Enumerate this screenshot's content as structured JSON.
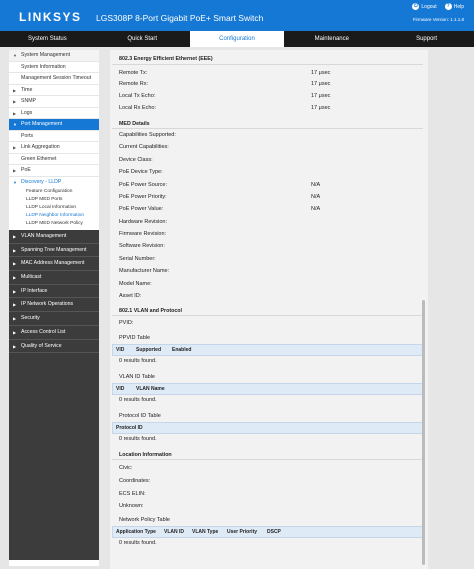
{
  "header": {
    "logo": "LINKSYS",
    "model": "LGS308P 8-Port Gigabit PoE+ Smart Switch",
    "logout": "Logout",
    "help": "Help",
    "firmware": "Firmware Version: 1.1.1.8"
  },
  "tabs": [
    "System Status",
    "Quick Start",
    "Configuration",
    "Maintenance",
    "Support"
  ],
  "sidebar": {
    "system_management": "System Management",
    "system_information": "System Information",
    "mgmt_session_timeout": "Management Session Timeout",
    "time": "Time",
    "snmp": "SNMP",
    "logs": "Logs",
    "port_management": "Port Management",
    "ports": "Ports",
    "link_aggregation": "Link Aggregation",
    "green_ethernet": "Green Ethernet",
    "poe": "PoE",
    "discovery_lldp": "Discovery - LLDP",
    "feature_configuration": "Feature Configuration",
    "lldp_med_ports": "LLDP MED Ports",
    "lldp_local_information": "LLDP Local Information",
    "lldp_neighbor_information": "LLDP Neighbor Information",
    "lldp_med_network_policy": "LLDP MED Network Policy",
    "vlan_management": "VLAN Management",
    "spanning_tree": "Spanning Tree Management",
    "mac_address": "MAC Address Management",
    "multicast": "Multicast",
    "ip_interface": "IP Interface",
    "ip_network_operations": "IP Network Operations",
    "security": "Security",
    "access_control_list": "Access Control List",
    "quality_of_service": "Quality of Service"
  },
  "content": {
    "eee_title": "802.3 Energy Efficient Ethernet (EEE)",
    "remote_tx": "Remote Tx:",
    "remote_tx_val": "17 μsec",
    "remote_rx": "Remote Rx:",
    "remote_rx_val": "17 μsec",
    "local_tx_echo": "Local Tx Echo:",
    "local_tx_echo_val": "17 μsec",
    "local_rx_echo": "Local Rx Echo:",
    "local_rx_echo_val": "17 μsec",
    "med_title": "MED Details",
    "capabilities_supported": "Capabilities Supported:",
    "current_capabilities": "Current Capabilities:",
    "device_class": "Device Class:",
    "poe_device_type": "PoE Device Type:",
    "poe_power_source": "PoE Power Source:",
    "poe_power_source_val": "N/A",
    "poe_power_priority": "PoE Power Priority:",
    "poe_power_priority_val": "N/A",
    "poe_power_value": "PoE Power Value:",
    "poe_power_value_val": "N/A",
    "hardware_revision": "Hardware Revision:",
    "firmware_revision": "Firmware Revision:",
    "software_revision": "Software Revision:",
    "serial_number": "Serial Number:",
    "manufacturer_name": "Manufacturer Name:",
    "model_name": "Model Name:",
    "asset_id": "Asset ID:",
    "vlan_protocol_title": "802.1 VLAN and Protocol",
    "pvid": "PVID:",
    "ppvid_table": "PPVID Table",
    "ppvid_cols": [
      "VID",
      "Supported",
      "Enabled"
    ],
    "ppvid_empty": "0 results found.",
    "vlan_id_table": "VLAN ID Table",
    "vlan_cols": [
      "VID",
      "VLAN Name"
    ],
    "vlan_empty": "0 results found.",
    "protocol_id_table": "Protocol ID Table",
    "protocol_cols": [
      "Protocol ID"
    ],
    "protocol_empty": "0 results found.",
    "location_title": "Location Information",
    "civic": "Civic:",
    "coordinates": "Coordinates:",
    "ecs_elin": "ECS ELIN:",
    "unknown": "Unknown:",
    "network_policy_table": "Network Policy Table",
    "policy_cols": [
      "Application Type",
      "VLAN ID",
      "VLAN Type",
      "User Priority",
      "DSCP"
    ],
    "policy_empty": "0 results found."
  }
}
